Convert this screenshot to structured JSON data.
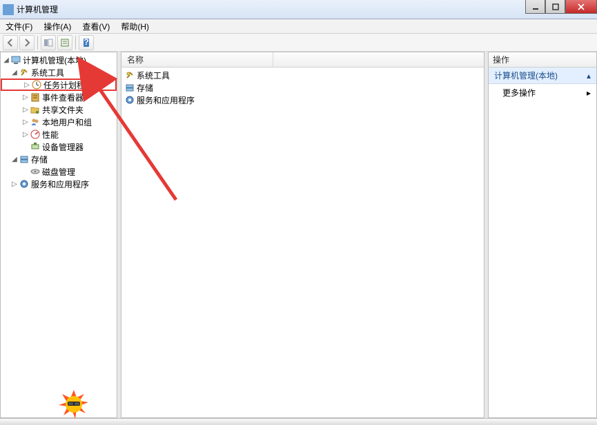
{
  "window": {
    "title": "计算机管理"
  },
  "menu": {
    "file": "文件(F)",
    "action": "操作(A)",
    "view": "查看(V)",
    "help": "帮助(H)"
  },
  "tree": {
    "root": "计算机管理(本地)",
    "system_tools": "系统工具",
    "task_scheduler": "任务计划程序",
    "event_viewer": "事件查看器",
    "shared_folders": "共享文件夹",
    "local_users": "本地用户和组",
    "performance": "性能",
    "device_manager": "设备管理器",
    "storage": "存储",
    "disk_mgmt": "磁盘管理",
    "services_apps": "服务和应用程序"
  },
  "list": {
    "col_name": "名称",
    "items": {
      "system_tools": "系统工具",
      "storage": "存储",
      "services_apps": "服务和应用程序"
    }
  },
  "actions": {
    "header": "操作",
    "section_title": "计算机管理(本地)",
    "more": "更多操作"
  }
}
